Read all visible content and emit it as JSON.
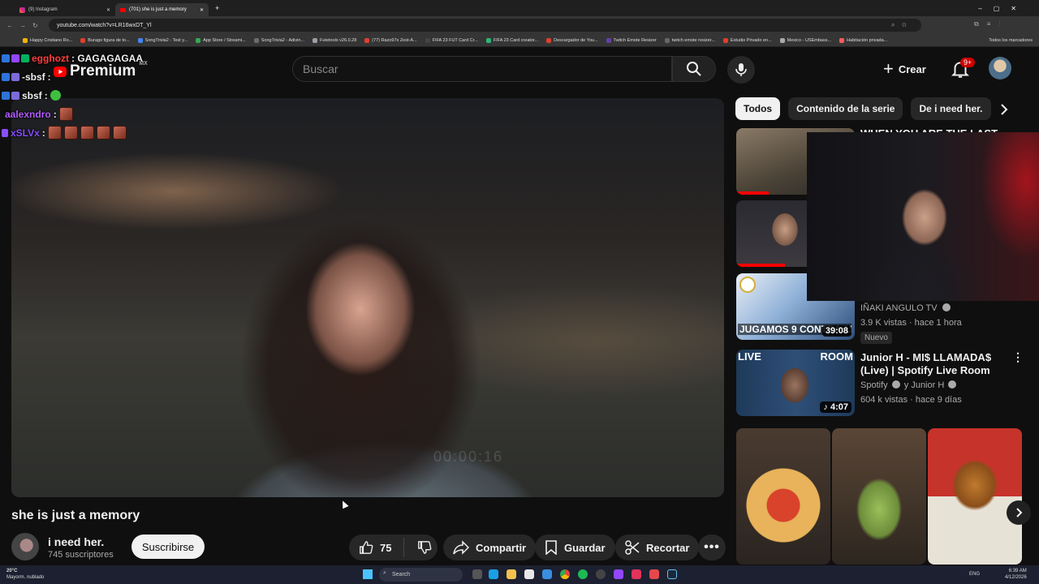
{
  "browser": {
    "tabs": [
      {
        "label": "(9) Instagram",
        "active": false
      },
      {
        "label": "(701) she is just a memory",
        "active": true
      }
    ],
    "url": "youtube.com/watch?v=LR16wxDT_Yl",
    "bookmarks": [
      "Happy Cristiano Ro...",
      "Burago figura de to...",
      "SongTrivia2 - Test y...",
      "App Store / Streami...",
      "SongTrivia2 - Adivin...",
      "Futetools v26.0.28",
      "(77) Razo97s Zest-A...",
      "FIFA 23 FUT Card Cr...",
      "FIFA 23 Card creator...",
      "Descargador de You...",
      "Twitch Emote Resizer",
      "twitch emote resizer...",
      "Estudio Privado en...",
      "Mexico - USEmbass...",
      "Habitación privada..."
    ],
    "all_bookmarks_label": "Todos los marcadores"
  },
  "chat_overlay": [
    {
      "user": "egghozt",
      "message": ": GAGAGAGAA",
      "user_color": "#ff4040"
    },
    {
      "user": "-sbsf",
      "message": ":",
      "user_color": "#ffffff"
    },
    {
      "user": "sbsf",
      "message": ":",
      "user_color": "#ffffff"
    },
    {
      "user": "aalexndro",
      "message": ":",
      "user_color": "#b05cff"
    },
    {
      "user": "xSLVx",
      "message": ":",
      "user_color": "#8a4dff"
    }
  ],
  "header": {
    "logo_text": "Premium",
    "logo_region": "MX",
    "search_placeholder": "Buscar",
    "create_label": "Crear",
    "notif_badge": "9+"
  },
  "video": {
    "title": "she is just a memory",
    "overlay_timecode": "00:00:16",
    "channel_name": "i need her.",
    "subscribers": "745 suscriptores",
    "subscribe_label": "Suscribirse",
    "likes": "75",
    "share_label": "Compartir",
    "save_label": "Guardar",
    "clip_label": "Recortar"
  },
  "filters": [
    "Todos",
    "Contenido de la serie",
    "De i need her."
  ],
  "recommendations": [
    {
      "title": "WHEN YOU ARE THE LAST ONE...",
      "channel": "",
      "meta": "",
      "duration": "",
      "tag": ""
    },
    {
      "title": "",
      "channel": "",
      "meta": "",
      "duration": "",
      "tag": ""
    },
    {
      "title": "",
      "channel": "IÑAKI ANGULO TV",
      "meta": "3.9 K vistas · hace 1 hora",
      "duration": "39:08",
      "tag": "Nuevo",
      "thumb_text": "JUGAMOS 9 CONTRA 11"
    },
    {
      "title": "Junior H - MI$ LLAMADA$ (Live) | Spotify Live Room",
      "channel": "Spotify",
      "channel_extra": "y Junior H",
      "meta": "604 k vistas · hace 9 días",
      "duration": "4:07",
      "tag": "",
      "thumb_left": "LIVE",
      "thumb_right": "ROOM"
    }
  ],
  "taskbar": {
    "weather_temp": "20°C",
    "weather_desc": "Mayorm. nublado",
    "search_label": "Search",
    "lang": "ENG",
    "time": "6:39 AM",
    "date": "4/12/2026"
  },
  "colors": {
    "youtube_red": "#ff0000",
    "background": "#0f0f0f",
    "chip_bg": "#272727"
  }
}
